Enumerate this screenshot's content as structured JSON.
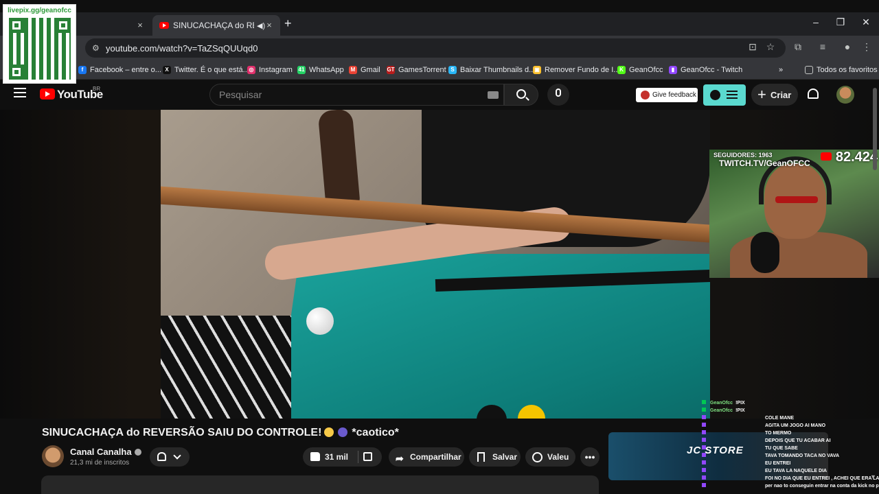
{
  "qr": {
    "label": "livepix.gg/geanofcc"
  },
  "browser": {
    "active_tab_title": "SINUCACHAÇA do REVERSÃO",
    "tab_close": "×",
    "new_tab": "+",
    "url": "youtube.com/watch?v=TaZSqQUUqd0",
    "bookmarks": [
      {
        "label": "Facebook – entre o...",
        "icon_color": "#1877f2",
        "icon": "f"
      },
      {
        "label": "Twitter. É o que está...",
        "icon_color": "#111111",
        "icon": "X"
      },
      {
        "label": "Instagram",
        "icon_color": "#e1306c",
        "icon": "◎"
      },
      {
        "label": "WhatsApp",
        "icon_color": "#25d366",
        "icon": "41"
      },
      {
        "label": "Gmail",
        "icon_color": "#ea4335",
        "icon": "M"
      },
      {
        "label": "GamesTorrent",
        "icon_color": "#b71c1c",
        "icon": "GT"
      },
      {
        "label": "Baixar Thumbnails d...",
        "icon_color": "#29b6f6",
        "icon": "S"
      },
      {
        "label": "Remover Fundo de I...",
        "icon_color": "#fbc02d",
        "icon": "▣"
      },
      {
        "label": "GeanOfcc",
        "icon_color": "#53fc18",
        "icon": "K"
      },
      {
        "label": "GeanOfcc - Twitch",
        "icon_color": "#9146ff",
        "icon": "▮"
      }
    ],
    "all_bookmarks": "Todos os favoritos"
  },
  "youtube": {
    "logo_text": "YouTube",
    "region": "BR",
    "search_placeholder": "Pesquisar",
    "feedback_label": "Give feedback",
    "create_label": "Criar"
  },
  "overlay": {
    "followers": "SEGUIDORES: 1963",
    "twitch_url": "TWITCH.TV/GeanOFCC",
    "sub_count": "82.424"
  },
  "video": {
    "title_part1": "SINUCACHAÇA do REVERSÃO SAIU DO CONTROLE!",
    "title_part2": "*caotico*",
    "channel_name": "Canal Canalha",
    "subscribers": "21,3 mi de inscritos",
    "likes": "31 mil",
    "share_label": "Compartilhar",
    "save_label": "Salvar",
    "thanks_label": "Valeu",
    "more_label": "•••"
  },
  "ad": {
    "brand": "JC STORE"
  },
  "chat": [
    {
      "user": "GeanOfcc",
      "message": "!PIX",
      "badge": "green"
    },
    {
      "user": "GeanOfcc",
      "message": "!PIX",
      "badge": "green"
    },
    {
      "user": "",
      "message": "COLE MANE",
      "badge": "sub"
    },
    {
      "user": "",
      "message": "AGITA UM JOGO AI MANO",
      "badge": "sub"
    },
    {
      "user": "",
      "message": "TO MERMO",
      "badge": "sub"
    },
    {
      "user": "",
      "message": "DEPOIS QUE TU ACABAR AI",
      "badge": "sub"
    },
    {
      "user": "",
      "message": "TU QUE SABE",
      "badge": "sub"
    },
    {
      "user": "",
      "message": "TAVA TOMANDO TACA NO VAVA",
      "badge": "sub"
    },
    {
      "user": "",
      "message": "EU ENTREI",
      "badge": "sub"
    },
    {
      "user": "",
      "message": "EU TAVA LA NAQUELE DIA",
      "badge": "sub"
    },
    {
      "user": "",
      "message": "FOI NO DIA QUE EU ENTREI , ACHEI QUE ERA LA",
      "badge": "sub"
    },
    {
      "user": "",
      "message": "per nao to conseguin entrar na conta da kick no pc",
      "badge": "sub"
    }
  ]
}
